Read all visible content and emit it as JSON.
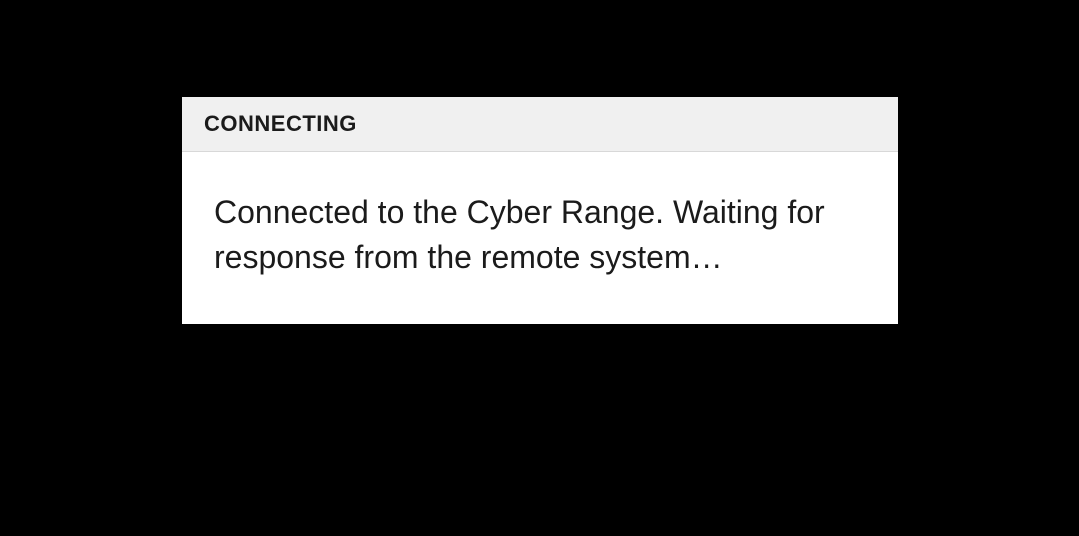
{
  "dialog": {
    "title": "CONNECTING",
    "message": "Connected to the Cyber Range. Waiting for response from the remote system…"
  }
}
